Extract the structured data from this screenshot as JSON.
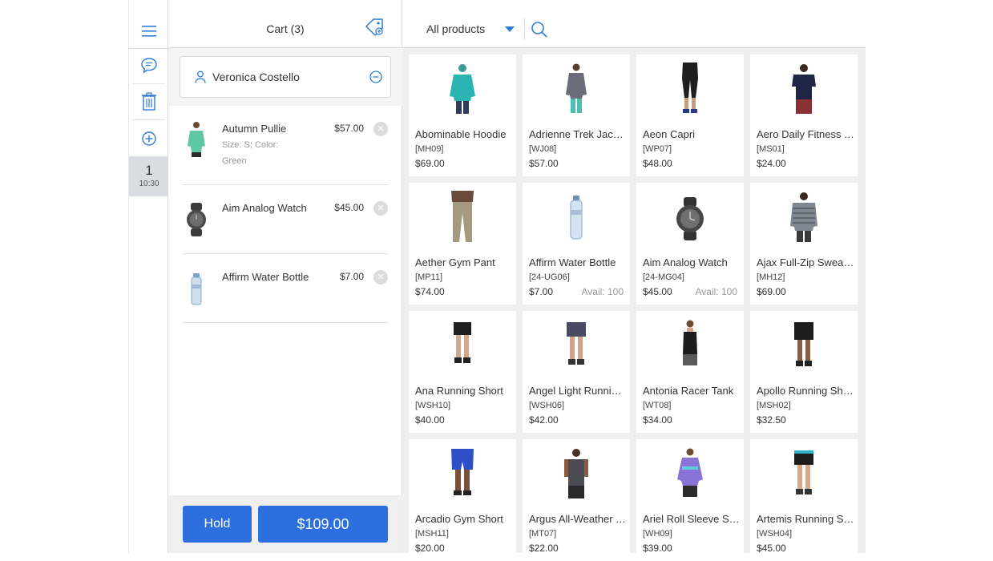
{
  "rail": {
    "active_tab_number": "1",
    "active_tab_time": "10:30"
  },
  "cart": {
    "title": "Cart (3)",
    "customer_name": "Veronica Costello",
    "items": [
      {
        "name": "Autumn Pullie",
        "options": "Size: S; Color: Green",
        "price": "$57.00"
      },
      {
        "name": "Aim Analog Watch",
        "options": "",
        "price": "$45.00"
      },
      {
        "name": "Affirm Water Bottle",
        "options": "",
        "price": "$7.00"
      }
    ],
    "hold_label": "Hold",
    "total_label": "$109.00"
  },
  "products": {
    "filter_label": "All products",
    "items": [
      {
        "name": "Abominable Hoodie",
        "sku": "[MH09]",
        "price": "$69.00",
        "avail": ""
      },
      {
        "name": "Adrienne Trek Jacket",
        "sku": "[WJ08]",
        "price": "$57.00",
        "avail": ""
      },
      {
        "name": "Aeon Capri",
        "sku": "[WP07]",
        "price": "$48.00",
        "avail": ""
      },
      {
        "name": "Aero Daily Fitness Tee",
        "sku": "[MS01]",
        "price": "$24.00",
        "avail": ""
      },
      {
        "name": "Aether Gym Pant",
        "sku": "[MP11]",
        "price": "$74.00",
        "avail": ""
      },
      {
        "name": "Affirm Water Bottle",
        "sku": "[24-UG06]",
        "price": "$7.00",
        "avail": "Avail: 100"
      },
      {
        "name": "Aim Analog Watch",
        "sku": "[24-MG04]",
        "price": "$45.00",
        "avail": "Avail: 100"
      },
      {
        "name": "Ajax Full-Zip Sweatshirt",
        "sku": "[MH12]",
        "price": "$69.00",
        "avail": ""
      },
      {
        "name": "Ana Running Short",
        "sku": "[WSH10]",
        "price": "$40.00",
        "avail": ""
      },
      {
        "name": "Angel Light Running Short",
        "sku": "[WSH06]",
        "price": "$42.00",
        "avail": ""
      },
      {
        "name": "Antonia Racer Tank",
        "sku": "[WT08]",
        "price": "$34.00",
        "avail": ""
      },
      {
        "name": "Apollo Running Short",
        "sku": "[MSH02]",
        "price": "$32.50",
        "avail": ""
      },
      {
        "name": "Arcadio Gym Short",
        "sku": "[MSH11]",
        "price": "$20.00",
        "avail": ""
      },
      {
        "name": "Argus All-Weather Tank",
        "sku": "[MT07]",
        "price": "$22.00",
        "avail": ""
      },
      {
        "name": "Ariel Roll Sleeve Sweatshirt",
        "sku": "[WH09]",
        "price": "$39.00",
        "avail": ""
      },
      {
        "name": "Artemis Running Short",
        "sku": "[WSH04]",
        "price": "$45.00",
        "avail": ""
      }
    ]
  },
  "colors": {
    "accent": "#2f7bd9",
    "button": "#2e6fe0"
  }
}
